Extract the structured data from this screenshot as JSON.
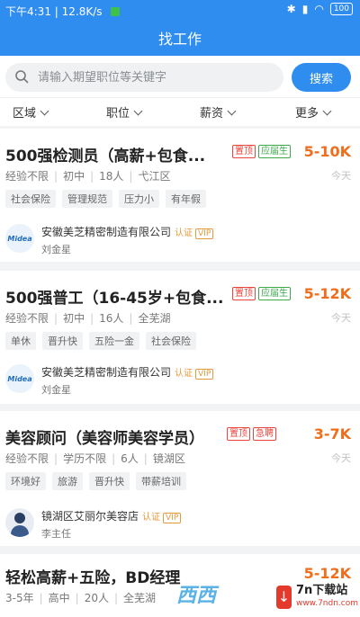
{
  "status_bar": {
    "time": "下午4:31",
    "speed": "12.8K/s",
    "battery": "100"
  },
  "header": {
    "title": "找工作"
  },
  "search": {
    "placeholder": "请输入期望职位等关键字",
    "button_label": "搜索"
  },
  "filters": [
    "区域",
    "职位",
    "薪资",
    "更多"
  ],
  "jobs": [
    {
      "title": "500强检测员（高薪+包食...",
      "badges": [
        "置顶",
        "应届生"
      ],
      "salary": "5-10K",
      "experience": "经验不限",
      "education": "初中",
      "headcount": "18人",
      "location": "弋江区",
      "date": "今天",
      "tags": [
        "社会保险",
        "管理规范",
        "压力小",
        "有年假"
      ],
      "company": "安徽美芝精密制造有限公司",
      "certified": "认证",
      "vip": "VIP",
      "logo": "Midea",
      "contact": "刘金星"
    },
    {
      "title": "500强普工（16-45岁+包食...",
      "badges": [
        "置顶",
        "应届生"
      ],
      "salary": "5-12K",
      "experience": "经验不限",
      "education": "初中",
      "headcount": "16人",
      "location": "全芜湖",
      "date": "今天",
      "tags": [
        "单休",
        "晋升快",
        "五险一金",
        "社会保险"
      ],
      "company": "安徽美芝精密制造有限公司",
      "certified": "认证",
      "vip": "VIP",
      "logo": "Midea",
      "contact": "刘金星"
    },
    {
      "title": "美容顾问（美容师美容学员）",
      "badges": [
        "置顶",
        "急聘"
      ],
      "salary": "3-7K",
      "experience": "经验不限",
      "education": "学历不限",
      "headcount": "6人",
      "location": "镜湖区",
      "date": "今天",
      "tags": [
        "环境好",
        "旅游",
        "晋升快",
        "带薪培训"
      ],
      "company": "镜湖区艾丽尔美容店",
      "certified": "认证",
      "vip": "VIP",
      "contact": "李主任"
    },
    {
      "title": "轻松高薪+五险，BD经理",
      "salary": "5-12K",
      "experience": "3-5年",
      "education": "高中",
      "headcount": "20人",
      "location": "全芜湖"
    }
  ],
  "watermark": {
    "left_text": "西西",
    "site_name": "7n下载站",
    "site_url": "www.7ndn.com"
  }
}
